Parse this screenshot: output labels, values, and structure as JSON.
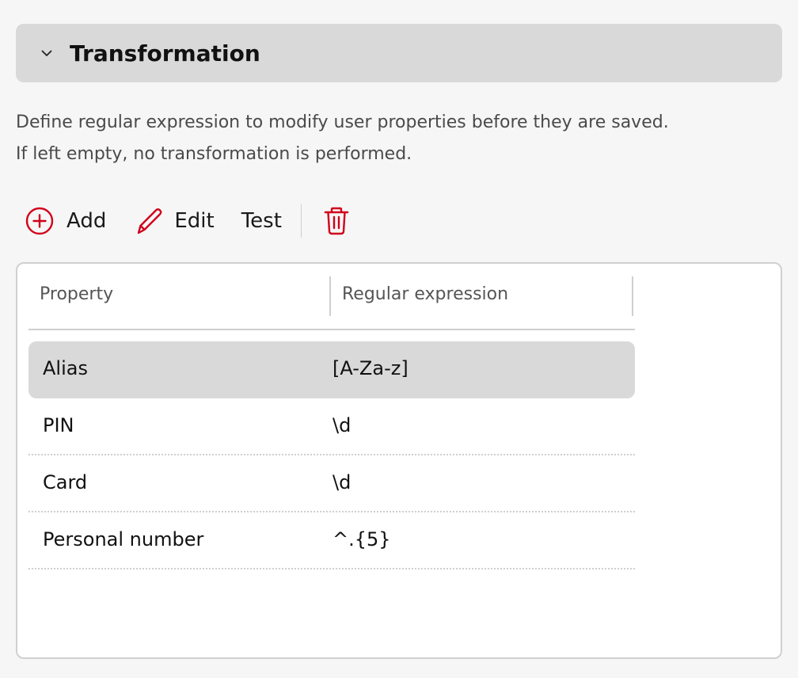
{
  "section": {
    "title": "Transformation",
    "expanded": true,
    "icon": "chevron-down-icon"
  },
  "description": {
    "line1": "Define regular expression to modify user properties before they are saved.",
    "line2": "If left empty, no transformation is performed."
  },
  "toolbar": {
    "add_label": "Add",
    "add_icon": "plus-circle-icon",
    "edit_label": "Edit",
    "edit_icon": "pencil-icon",
    "test_label": "Test",
    "delete_icon": "trash-icon",
    "accent_color": "#d0021b"
  },
  "table": {
    "columns": [
      "Property",
      "Regular expression"
    ],
    "rows": [
      {
        "property": "Alias",
        "regex": "[A-Za-z]",
        "selected": true
      },
      {
        "property": "PIN",
        "regex": "\\d",
        "selected": false
      },
      {
        "property": "Card",
        "regex": "\\d",
        "selected": false
      },
      {
        "property": "Personal number",
        "regex": "^.{5}",
        "selected": false
      }
    ]
  }
}
